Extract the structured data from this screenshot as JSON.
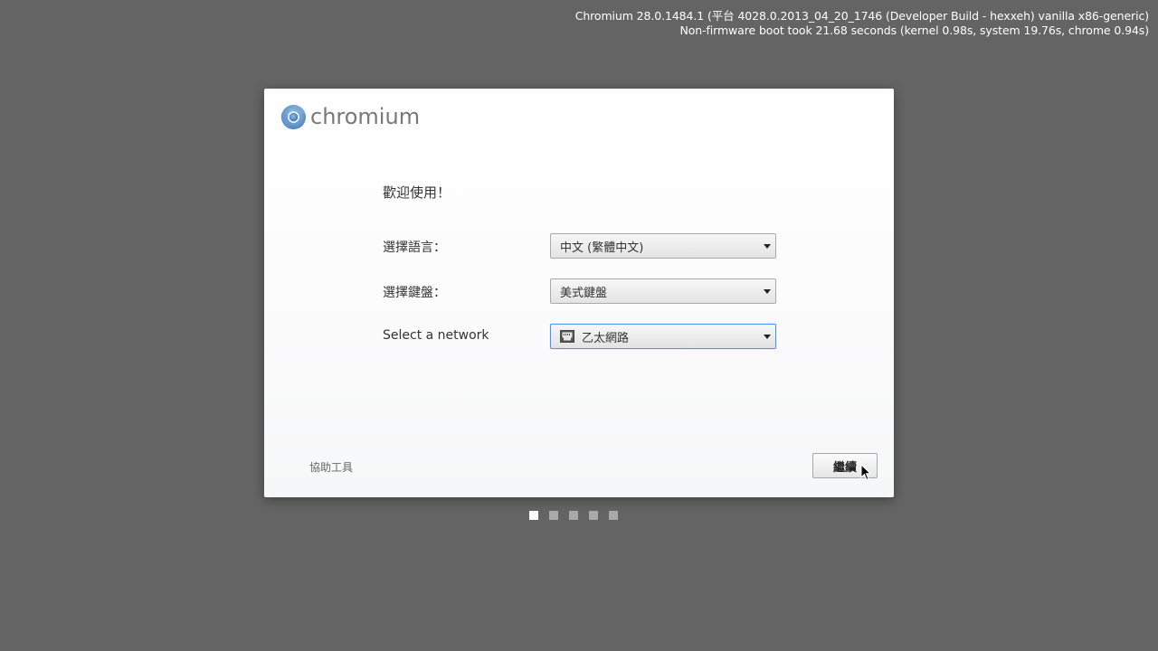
{
  "system_info": {
    "version_line": "Chromium 28.0.1484.1 (平台 4028.0.2013_04_20_1746 (Developer Build - hexxeh) vanilla x86-generic)",
    "boot_line": "Non-firmware boot took 21.68 seconds (kernel 0.98s, system 19.76s, chrome 0.94s)"
  },
  "dialog": {
    "logo_text": "chromium",
    "welcome_title": "歡迎使用！",
    "fields": {
      "language": {
        "label": "選擇語言：",
        "value": "中文 (繁體中文)"
      },
      "keyboard": {
        "label": "選擇鍵盤：",
        "value": "美式鍵盤"
      },
      "network": {
        "label": "Select a network",
        "value": "乙太網路",
        "icon": "ethernet-icon"
      }
    },
    "accessibility_label": "協助工具",
    "continue_label": "繼續"
  },
  "steps": {
    "total": 5,
    "current": 1
  },
  "colors": {
    "background": "#636463",
    "dialog": "#ffffff",
    "focus_border": "#4d90fe",
    "active_step": "#ffffff",
    "inactive_step": "#a9a9a9"
  }
}
